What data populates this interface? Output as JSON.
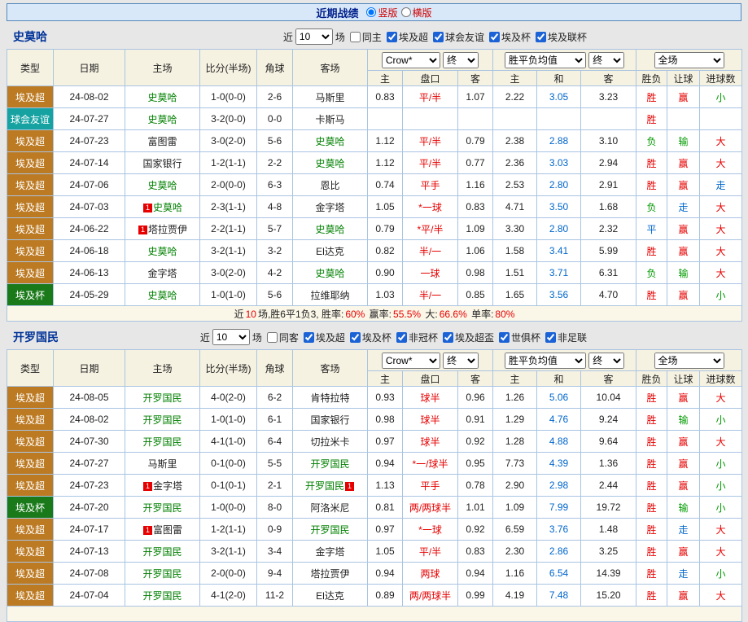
{
  "top_bar": {
    "title": "近期战绩",
    "vertical_label": "竖版",
    "horizontal_label": "横版"
  },
  "table_header": {
    "type": "类型",
    "date": "日期",
    "home": "主场",
    "score": "比分(半场)",
    "corner": "角球",
    "away": "客场",
    "sub": [
      "主",
      "盘口",
      "客",
      "主",
      "和",
      "客",
      "胜负",
      "让球",
      "进球数"
    ],
    "selects": {
      "bookmaker": "Crow*",
      "stage": "终",
      "europe": "胜平负均值",
      "fulltime": "全场"
    }
  },
  "colors": {
    "accent_border": "#5588bb",
    "super": "#bc7a23",
    "friendly": "#17a2a2",
    "cup": "#1a7a1a",
    "win": "#e60000",
    "lose": "#009900",
    "push": "#0066cc",
    "team": "#008000"
  },
  "sections": [
    {
      "title": "史莫哈",
      "filter": {
        "near": "近",
        "count": "10",
        "games": "场",
        "same": "同主",
        "leagues": [
          "埃及超",
          "球会友谊",
          "埃及杯",
          "埃及联杯"
        ]
      },
      "rows": [
        {
          "type": "埃及超",
          "date": "24-08-02",
          "home": "史莫哈",
          "hf": true,
          "hb": false,
          "score": "1-0(0-0)",
          "corner": "2-6",
          "away": "马斯里",
          "af": false,
          "ab": false,
          "asian": [
            "0.83",
            "平/半",
            "1.07"
          ],
          "europe": [
            "2.22",
            "3.05",
            "3.23"
          ],
          "res": [
            "胜",
            "赢",
            "小"
          ]
        },
        {
          "type": "球会友谊",
          "date": "24-07-27",
          "home": "史莫哈",
          "hf": true,
          "hb": false,
          "score": "3-2(0-0)",
          "corner": "0-0",
          "away": "卡斯马",
          "af": false,
          "ab": false,
          "asian": [
            "",
            "",
            ""
          ],
          "europe": [
            "",
            "",
            ""
          ],
          "res": [
            "胜",
            "",
            ""
          ]
        },
        {
          "type": "埃及超",
          "date": "24-07-23",
          "home": "富图雷",
          "hf": false,
          "hb": false,
          "score": "3-0(2-0)",
          "corner": "5-6",
          "away": "史莫哈",
          "af": true,
          "ab": false,
          "asian": [
            "1.12",
            "平/半",
            "0.79"
          ],
          "europe": [
            "2.38",
            "2.88",
            "3.10"
          ],
          "res": [
            "负",
            "输",
            "大"
          ]
        },
        {
          "type": "埃及超",
          "date": "24-07-14",
          "home": "国家银行",
          "hf": false,
          "hb": false,
          "score": "1-2(1-1)",
          "corner": "2-2",
          "away": "史莫哈",
          "af": true,
          "ab": false,
          "asian": [
            "1.12",
            "平/半",
            "0.77"
          ],
          "europe": [
            "2.36",
            "3.03",
            "2.94"
          ],
          "res": [
            "胜",
            "赢",
            "大"
          ]
        },
        {
          "type": "埃及超",
          "date": "24-07-06",
          "home": "史莫哈",
          "hf": true,
          "hb": false,
          "score": "2-0(0-0)",
          "corner": "6-3",
          "away": "恩比",
          "af": false,
          "ab": false,
          "asian": [
            "0.74",
            "平手",
            "1.16"
          ],
          "europe": [
            "2.53",
            "2.80",
            "2.91"
          ],
          "res": [
            "胜",
            "赢",
            "走"
          ]
        },
        {
          "type": "埃及超",
          "date": "24-07-03",
          "home": "史莫哈",
          "hf": true,
          "hb": true,
          "score": "2-3(1-1)",
          "corner": "4-8",
          "away": "金字塔",
          "af": false,
          "ab": false,
          "asian": [
            "1.05",
            "*一球",
            "0.83"
          ],
          "europe": [
            "4.71",
            "3.50",
            "1.68"
          ],
          "res": [
            "负",
            "走",
            "大"
          ]
        },
        {
          "type": "埃及超",
          "date": "24-06-22",
          "home": "塔拉贾伊",
          "hf": false,
          "hb": true,
          "score": "2-2(1-1)",
          "corner": "5-7",
          "away": "史莫哈",
          "af": true,
          "ab": false,
          "asian": [
            "0.79",
            "*平/半",
            "1.09"
          ],
          "europe": [
            "3.30",
            "2.80",
            "2.32"
          ],
          "res": [
            "平",
            "赢",
            "大"
          ]
        },
        {
          "type": "埃及超",
          "date": "24-06-18",
          "home": "史莫哈",
          "hf": true,
          "hb": false,
          "score": "3-2(1-1)",
          "corner": "3-2",
          "away": "El达克",
          "af": false,
          "ab": false,
          "asian": [
            "0.82",
            "半/一",
            "1.06"
          ],
          "europe": [
            "1.58",
            "3.41",
            "5.99"
          ],
          "res": [
            "胜",
            "赢",
            "大"
          ]
        },
        {
          "type": "埃及超",
          "date": "24-06-13",
          "home": "金字塔",
          "hf": false,
          "hb": false,
          "score": "3-0(2-0)",
          "corner": "4-2",
          "away": "史莫哈",
          "af": true,
          "ab": false,
          "asian": [
            "0.90",
            "一球",
            "0.98"
          ],
          "europe": [
            "1.51",
            "3.71",
            "6.31"
          ],
          "res": [
            "负",
            "输",
            "大"
          ]
        },
        {
          "type": "埃及杯",
          "date": "24-05-29",
          "home": "史莫哈",
          "hf": true,
          "hb": false,
          "score": "1-0(1-0)",
          "corner": "5-6",
          "away": "拉维耶纳",
          "af": false,
          "ab": false,
          "asian": [
            "1.03",
            "半/一",
            "0.85"
          ],
          "europe": [
            "1.65",
            "3.56",
            "4.70"
          ],
          "res": [
            "胜",
            "赢",
            "小"
          ]
        }
      ],
      "summary": [
        {
          "t": "近"
        },
        {
          "t": "10",
          "r": true
        },
        {
          "t": "场,胜6平1负3, 胜率:"
        },
        {
          "t": "60%",
          "r": true
        },
        {
          "t": " 赢率:"
        },
        {
          "t": "55.5%",
          "r": true
        },
        {
          "t": " 大:"
        },
        {
          "t": "66.6%",
          "r": true
        },
        {
          "t": " 单率:"
        },
        {
          "t": "80%",
          "r": true
        }
      ]
    },
    {
      "title": "开罗国民",
      "filter": {
        "near": "近",
        "count": "10",
        "games": "场",
        "same": "同客",
        "leagues": [
          "埃及超",
          "埃及杯",
          "非冠杯",
          "埃及超盃",
          "世俱杯",
          "非足联"
        ]
      },
      "rows": [
        {
          "type": "埃及超",
          "date": "24-08-05",
          "home": "开罗国民",
          "hf": true,
          "hb": false,
          "score": "4-0(2-0)",
          "corner": "6-2",
          "away": "肯特拉特",
          "af": false,
          "ab": false,
          "asian": [
            "0.93",
            "球半",
            "0.96"
          ],
          "europe": [
            "1.26",
            "5.06",
            "10.04"
          ],
          "res": [
            "胜",
            "赢",
            "大"
          ]
        },
        {
          "type": "埃及超",
          "date": "24-08-02",
          "home": "开罗国民",
          "hf": true,
          "hb": false,
          "score": "1-0(1-0)",
          "corner": "6-1",
          "away": "国家银行",
          "af": false,
          "ab": false,
          "asian": [
            "0.98",
            "球半",
            "0.91"
          ],
          "europe": [
            "1.29",
            "4.76",
            "9.24"
          ],
          "res": [
            "胜",
            "输",
            "小"
          ]
        },
        {
          "type": "埃及超",
          "date": "24-07-30",
          "home": "开罗国民",
          "hf": true,
          "hb": false,
          "score": "4-1(1-0)",
          "corner": "6-4",
          "away": "切拉米卡",
          "af": false,
          "ab": false,
          "asian": [
            "0.97",
            "球半",
            "0.92"
          ],
          "europe": [
            "1.28",
            "4.88",
            "9.64"
          ],
          "res": [
            "胜",
            "赢",
            "大"
          ]
        },
        {
          "type": "埃及超",
          "date": "24-07-27",
          "home": "马斯里",
          "hf": false,
          "hb": false,
          "score": "0-1(0-0)",
          "corner": "5-5",
          "away": "开罗国民",
          "af": true,
          "ab": false,
          "asian": [
            "0.94",
            "*一/球半",
            "0.95"
          ],
          "europe": [
            "7.73",
            "4.39",
            "1.36"
          ],
          "res": [
            "胜",
            "赢",
            "小"
          ]
        },
        {
          "type": "埃及超",
          "date": "24-07-23",
          "home": "金字塔",
          "hf": false,
          "hb": true,
          "score": "0-1(0-1)",
          "corner": "2-1",
          "away": "开罗国民",
          "af": true,
          "ab": true,
          "asian": [
            "1.13",
            "平手",
            "0.78"
          ],
          "europe": [
            "2.90",
            "2.98",
            "2.44"
          ],
          "res": [
            "胜",
            "赢",
            "小"
          ]
        },
        {
          "type": "埃及杯",
          "date": "24-07-20",
          "home": "开罗国民",
          "hf": true,
          "hb": false,
          "score": "1-0(0-0)",
          "corner": "8-0",
          "away": "阿洛米尼",
          "af": false,
          "ab": false,
          "asian": [
            "0.81",
            "两/两球半",
            "1.01"
          ],
          "europe": [
            "1.09",
            "7.99",
            "19.72"
          ],
          "res": [
            "胜",
            "输",
            "小"
          ]
        },
        {
          "type": "埃及超",
          "date": "24-07-17",
          "home": "富图雷",
          "hf": false,
          "hb": true,
          "score": "1-2(1-1)",
          "corner": "0-9",
          "away": "开罗国民",
          "af": true,
          "ab": false,
          "asian": [
            "0.97",
            "*一球",
            "0.92"
          ],
          "europe": [
            "6.59",
            "3.76",
            "1.48"
          ],
          "res": [
            "胜",
            "走",
            "大"
          ]
        },
        {
          "type": "埃及超",
          "date": "24-07-13",
          "home": "开罗国民",
          "hf": true,
          "hb": false,
          "score": "3-2(1-1)",
          "corner": "3-4",
          "away": "金字塔",
          "af": false,
          "ab": false,
          "asian": [
            "1.05",
            "平/半",
            "0.83"
          ],
          "europe": [
            "2.30",
            "2.86",
            "3.25"
          ],
          "res": [
            "胜",
            "赢",
            "大"
          ]
        },
        {
          "type": "埃及超",
          "date": "24-07-08",
          "home": "开罗国民",
          "hf": true,
          "hb": false,
          "score": "2-0(0-0)",
          "corner": "9-4",
          "away": "塔拉贾伊",
          "af": false,
          "ab": false,
          "asian": [
            "0.94",
            "两球",
            "0.94"
          ],
          "europe": [
            "1.16",
            "6.54",
            "14.39"
          ],
          "res": [
            "胜",
            "走",
            "小"
          ]
        },
        {
          "type": "埃及超",
          "date": "24-07-04",
          "home": "开罗国民",
          "hf": true,
          "hb": false,
          "score": "4-1(2-0)",
          "corner": "11-2",
          "away": "El达克",
          "af": false,
          "ab": false,
          "asian": [
            "0.89",
            "两/两球半",
            "0.99"
          ],
          "europe": [
            "4.19",
            "7.48",
            "15.20"
          ],
          "res": [
            "胜",
            "赢",
            "大"
          ]
        }
      ],
      "summary": []
    }
  ]
}
